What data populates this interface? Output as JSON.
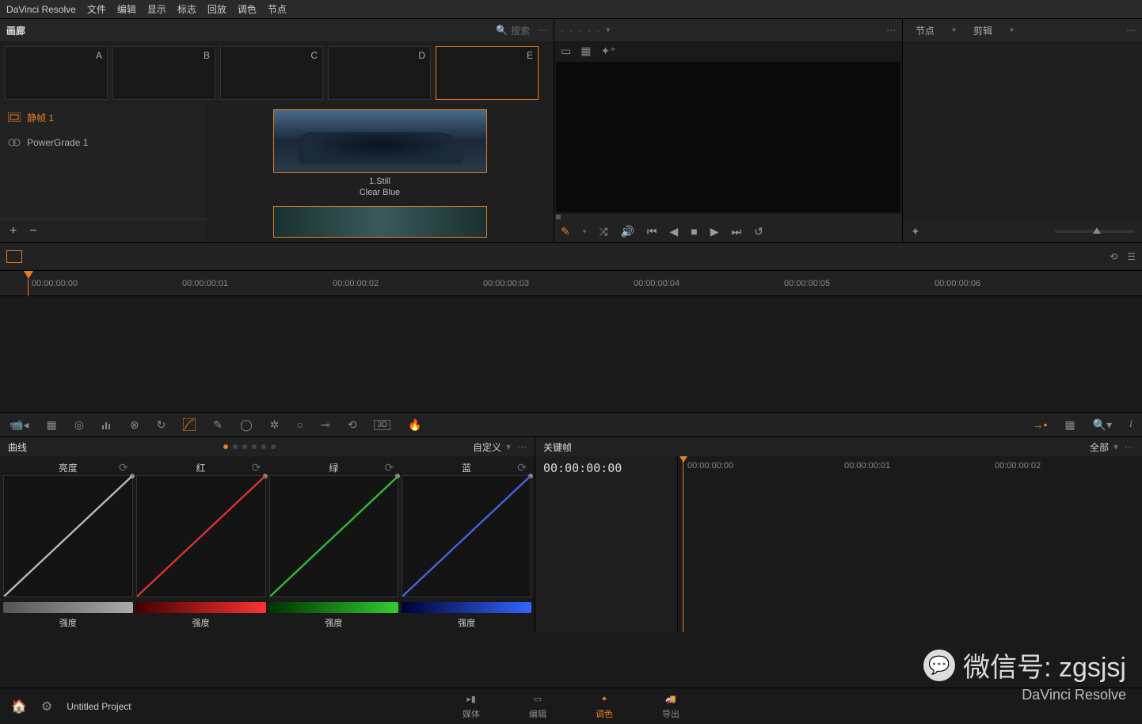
{
  "app_name": "DaVinci Resolve",
  "menu": [
    "文件",
    "编辑",
    "显示",
    "标志",
    "回放",
    "调色",
    "节点"
  ],
  "gallery": {
    "title": "画廊",
    "search_placeholder": "搜索",
    "thumbs": [
      "A",
      "B",
      "C",
      "D",
      "E"
    ],
    "selected_thumb": 4,
    "sidebar": [
      {
        "label": "静帧 1",
        "active": true
      },
      {
        "label": "PowerGrade 1",
        "active": false
      }
    ],
    "stills": [
      {
        "title": "1.Still",
        "subtitle": "Clear Blue"
      }
    ]
  },
  "nodes_header": {
    "tab1": "节点",
    "tab2": "剪辑"
  },
  "ruler_ticks": [
    "00:00:00:00",
    "00:00:00:01",
    "00:00:00:02",
    "00:00:00:03",
    "00:00:00:04",
    "00:00:00:05",
    "00:00:00:06"
  ],
  "curves": {
    "title": "曲线",
    "mode": "自定义",
    "channels": [
      {
        "name": "亮度",
        "color": "#bbbbbb",
        "slider_label": "强度",
        "slider_bg": "linear-gradient(90deg,#555,#aaa)"
      },
      {
        "name": "红",
        "color": "#dd3333",
        "slider_label": "强度",
        "slider_bg": "linear-gradient(90deg,#400,#f33)"
      },
      {
        "name": "绿",
        "color": "#33bb33",
        "slider_label": "强度",
        "slider_bg": "linear-gradient(90deg,#030,#3c3)"
      },
      {
        "name": "蓝",
        "color": "#4466dd",
        "slider_label": "强度",
        "slider_bg": "linear-gradient(90deg,#003,#36f)"
      }
    ]
  },
  "keyframes": {
    "title": "关键帧",
    "mode": "全部",
    "timecode": "00:00:00:00",
    "ticks": [
      "00:00:00:00",
      "00:00:00:01",
      "00:00:00:02"
    ]
  },
  "project_name": "Untitled Project",
  "pages": [
    {
      "label": "媒体",
      "active": false
    },
    {
      "label": "编辑",
      "active": false
    },
    {
      "label": "调色",
      "active": true
    },
    {
      "label": "导出",
      "active": false
    }
  ],
  "watermark": {
    "main": "微信号: zgsjsj",
    "sub": "DaVinci Resolve"
  }
}
